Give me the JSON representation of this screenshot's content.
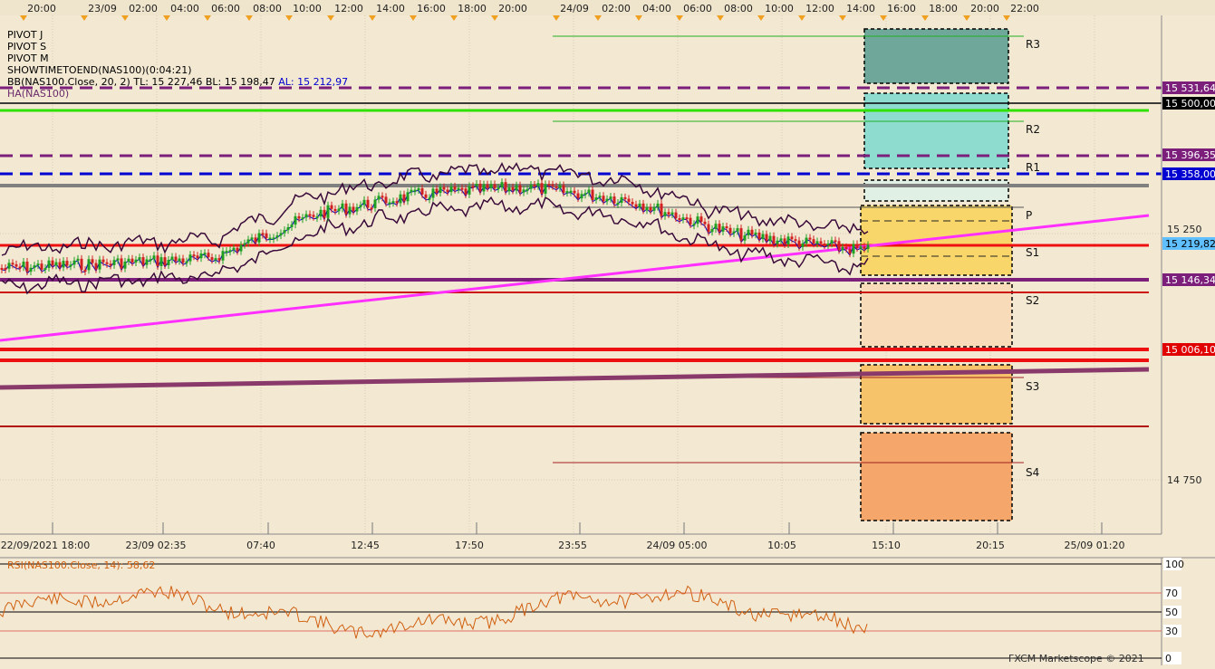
{
  "top_time_axis": [
    "20:00",
    "23/09",
    "02:00",
    "04:00",
    "06:00",
    "08:00",
    "10:00",
    "12:00",
    "14:00",
    "16:00",
    "18:00",
    "20:00",
    "24/09",
    "02:00",
    "04:00",
    "06:00",
    "08:00",
    "10:00",
    "12:00",
    "14:00",
    "16:00",
    "18:00",
    "20:00",
    "22:00"
  ],
  "indicators": {
    "pivot_j": "PIVOT J",
    "pivot_s": "PIVOT S",
    "pivot_m": "PIVOT M",
    "showtime": "SHOWTIMETOEND(NAS100)(0:04:21)",
    "bb_prefix": "BB(NAS100.Close, 20, 2)  TL: 15 227,46  BL: 15 198,47",
    "bb_al": "AL: 15 212,97",
    "ha": "HA(NAS100)"
  },
  "pivot_labels": [
    "R3",
    "R2",
    "R1",
    "P",
    "S1",
    "S2",
    "S3",
    "S4"
  ],
  "price_axis": {
    "plain_ticks": [
      "15 250",
      "14 750"
    ],
    "boxes": [
      {
        "text": "15 531,64",
        "bg": "#7b1f7b",
        "fg": "#ffffff"
      },
      {
        "text": "15 500,00",
        "bg": "#000000",
        "fg": "#ffffff"
      },
      {
        "text": "15 396,35",
        "bg": "#7b1f7b",
        "fg": "#ffffff"
      },
      {
        "text": "15 358,00",
        "bg": "#0000d0",
        "fg": "#ffffff"
      },
      {
        "text": "15 219,82",
        "bg": "#5fbfff",
        "fg": "#000000"
      },
      {
        "text": "15 146,34",
        "bg": "#7b1f7b",
        "fg": "#ffffff"
      },
      {
        "text": "15 006,10",
        "bg": "#e00000",
        "fg": "#ffffff"
      }
    ]
  },
  "bottom_time_axis": [
    "22/09/2021 18:00",
    "23/09 02:35",
    "07:40",
    "12:45",
    "17:50",
    "23:55",
    "24/09 05:00",
    "10:05",
    "15:10",
    "20:15",
    "25/09 01:20"
  ],
  "rsi": {
    "label": "RSI(NAS100.Close, 14): 58,62",
    "levels": [
      "100",
      "70",
      "50",
      "30",
      "0"
    ],
    "color": "#d06010"
  },
  "watermark": "FXCM Marketscope © 2021",
  "colors": {
    "background": "#f3e9d3",
    "bb_band": "#3a0a3a",
    "ma": "#0000c0",
    "candle_up": "#20a020",
    "candle_down": "#d02020",
    "trendline": "#ff30ff",
    "pivot_purple": "#7b1f7b",
    "green_line": "#30e000",
    "red_line": "#ee1010"
  },
  "chart_data": {
    "type": "line",
    "title": "",
    "xlabel": "",
    "ylabel": "",
    "ylim": [
      14640,
      15640
    ],
    "x": [
      "22/09/2021 18:00",
      "23/09 02:35",
      "07:40",
      "12:45",
      "17:50",
      "23:55",
      "24/09 05:00",
      "10:05",
      "15:10"
    ],
    "series": [
      {
        "values": [
          15180,
          15190,
          15200,
          15290,
          15330,
          15345,
          15320,
          15250,
          15215
        ]
      }
    ],
    "horizontal_levels": [
      15531.64,
      15500.0,
      15396.35,
      15358.0,
      15219.82,
      15146.34,
      15006.1
    ]
  }
}
